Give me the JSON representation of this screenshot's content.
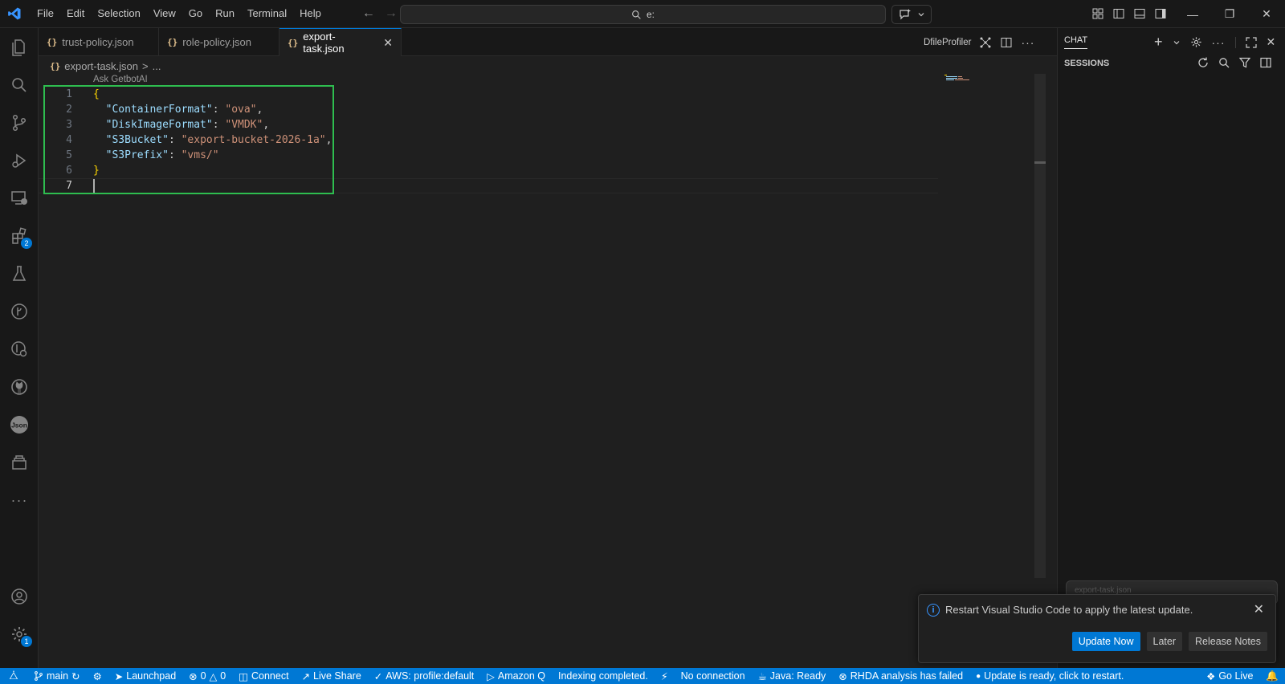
{
  "menu": [
    "File",
    "Edit",
    "Selection",
    "View",
    "Go",
    "Run",
    "Terminal",
    "Help"
  ],
  "search": {
    "text": "e:"
  },
  "tabs": [
    {
      "icon": "{}",
      "label": "trust-policy.json"
    },
    {
      "icon": "{}",
      "label": "role-policy.json"
    },
    {
      "icon": "{}",
      "label": "export-task.json"
    }
  ],
  "editor_actions": {
    "profiler_label": "DfileProfiler"
  },
  "breadcrumb": {
    "icon": "{}",
    "file": "export-task.json",
    "sep": ">",
    "more": "..."
  },
  "codelens": "Ask GetbotAI",
  "editor": {
    "line_numbers": [
      "1",
      "2",
      "3",
      "4",
      "5",
      "6",
      "7"
    ],
    "json": {
      "open": "{",
      "close": "}",
      "entries": [
        {
          "key": "\"ContainerFormat\"",
          "value": "\"ova\"",
          "trail": ","
        },
        {
          "key": "\"DiskImageFormat\"",
          "value": "\"VMDK\"",
          "trail": ","
        },
        {
          "key": "\"S3Bucket\"",
          "value": "\"export-bucket-2026-1a\"",
          "trail": ","
        },
        {
          "key": "\"S3Prefix\"",
          "value": "\"vms/\"",
          "trail": ""
        }
      ]
    }
  },
  "activity_badges": {
    "extensions": "2",
    "accounts_settings": "1"
  },
  "chat": {
    "title": "CHAT",
    "sessions_title": "SESSIONS",
    "input_stub": "export-task.json"
  },
  "notification": {
    "message": "Restart Visual Studio Code to apply the latest update.",
    "primary_btn": "Update Now",
    "later_btn": "Later",
    "notes_btn": "Release Notes"
  },
  "statusbar": {
    "branch": "main",
    "launchpad": "Launchpad",
    "errors": "0",
    "warnings": "0",
    "connect": "Connect",
    "live_share": "Live Share",
    "aws": "AWS: profile:default",
    "amazon_q": "Amazon Q",
    "indexing": "Indexing completed.",
    "no_connection": "No connection",
    "java": "Java: Ready",
    "rhda": "RHDA analysis has failed",
    "update": "Update is ready, click to restart.",
    "go_live": "Go Live"
  },
  "colors": {
    "accent": "#0078d4",
    "highlight_box": "#2ebd4f",
    "json_key": "#9cdcfe",
    "json_string": "#ce9178",
    "brace": "#ffd700"
  }
}
